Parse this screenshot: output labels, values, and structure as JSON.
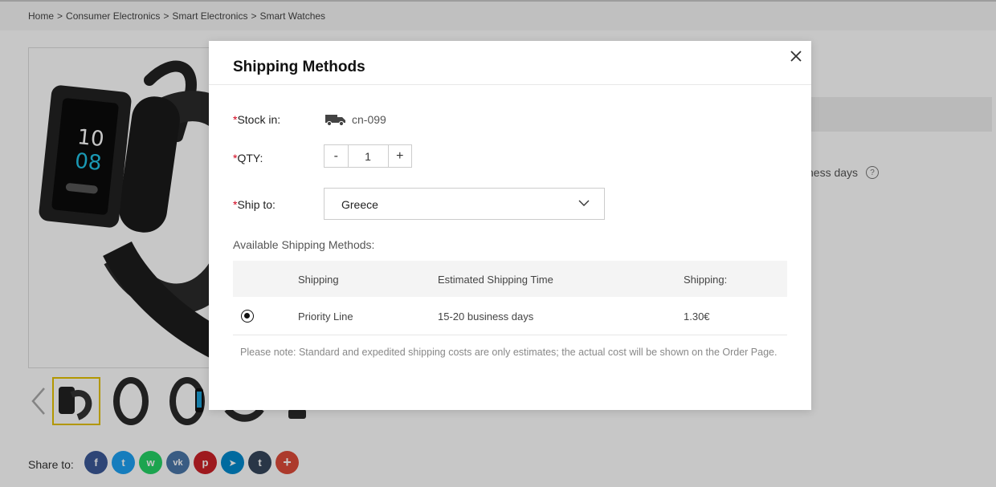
{
  "breadcrumb": {
    "items": [
      "Home",
      "Consumer Electronics",
      "Smart Electronics",
      "Smart Watches"
    ],
    "separator": ">"
  },
  "share": {
    "label": "Share to:",
    "icons": [
      {
        "name": "facebook-icon",
        "glyph": "f",
        "color": "#3b5998"
      },
      {
        "name": "twitter-icon",
        "glyph": "t",
        "color": "#1da1f2"
      },
      {
        "name": "whatsapp-icon",
        "glyph": "w",
        "color": "#25d366"
      },
      {
        "name": "vk-icon",
        "glyph": "vk",
        "color": "#4a76a8"
      },
      {
        "name": "pinterest-icon",
        "glyph": "p",
        "color": "#cb2027"
      },
      {
        "name": "telegram-icon",
        "glyph": "➤",
        "color": "#0088cc"
      },
      {
        "name": "tumblr-icon",
        "glyph": "t",
        "color": "#35465c"
      },
      {
        "name": "more-share-icon",
        "glyph": "+",
        "color": "#dd4b39"
      }
    ]
  },
  "background": {
    "delivery_text": "ness days"
  },
  "modal": {
    "title": "Shipping Methods",
    "stock_label": "Stock in:",
    "stock_value": "cn-099",
    "qty_label": "QTY:",
    "qty_minus": "-",
    "qty_plus": "+",
    "qty_value": "1",
    "ship_to_label": "Ship to:",
    "ship_to_value": "Greece",
    "required_mark": "*",
    "available_label": "Available Shipping Methods:",
    "table": {
      "headers": [
        "Shipping",
        "Estimated Shipping Time",
        "Shipping:"
      ],
      "rows": [
        {
          "method": "Priority Line",
          "time": "15-20 business days",
          "cost": "1.30€",
          "selected": true
        }
      ]
    },
    "note": "Please note: Standard and expedited shipping costs are only estimates; the actual cost will be shown on the Order Page."
  },
  "colors": {
    "required": "#d0021b",
    "thumb_active_border": "#e5c200"
  }
}
